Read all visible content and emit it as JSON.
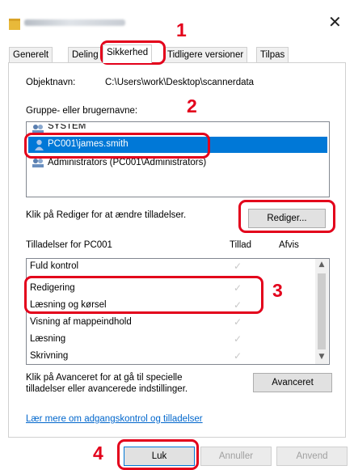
{
  "window": {
    "close_glyph": "✕"
  },
  "tabs": [
    "Generelt",
    "Deling",
    "Sikkerhed",
    "Tidligere versioner",
    "Tilpas"
  ],
  "object": {
    "label": "Objektnavn:",
    "value": "C:\\Users\\work\\Desktop\\scannerdata"
  },
  "groups": {
    "label": "Gruppe- eller brugernavne:",
    "items": [
      "SYSTEM",
      "PC001\\james.smith",
      "Administrators (PC001\\Administrators)"
    ],
    "selected_index": 1
  },
  "edit": {
    "hint": "Klik på Rediger for at ændre tilladelser.",
    "button": "Rediger..."
  },
  "permissions": {
    "label": "Tilladelser for PC001",
    "col_allow": "Tillad",
    "col_deny": "Afvis",
    "rows": [
      "Fuld kontrol",
      "Redigering",
      "Læsning og kørsel",
      "Visning af mappeindhold",
      "Læsning",
      "Skrivning"
    ],
    "check_glyph": "✓"
  },
  "advanced": {
    "hint_line1": "Klik på Avanceret for at gå til specielle",
    "hint_line2": "tilladelser eller avancerede indstillinger.",
    "button": "Avanceret"
  },
  "learn_more": "Lær mere om adgangskontrol og tilladelser",
  "footer": {
    "ok": "Luk",
    "cancel": "Annuller",
    "apply": "Anvend"
  },
  "callouts": [
    "1",
    "2",
    "3",
    "4"
  ],
  "colors": {
    "callout_red": "#e3001b",
    "selection_blue": "#0078d7",
    "link_blue": "#0066cc"
  }
}
